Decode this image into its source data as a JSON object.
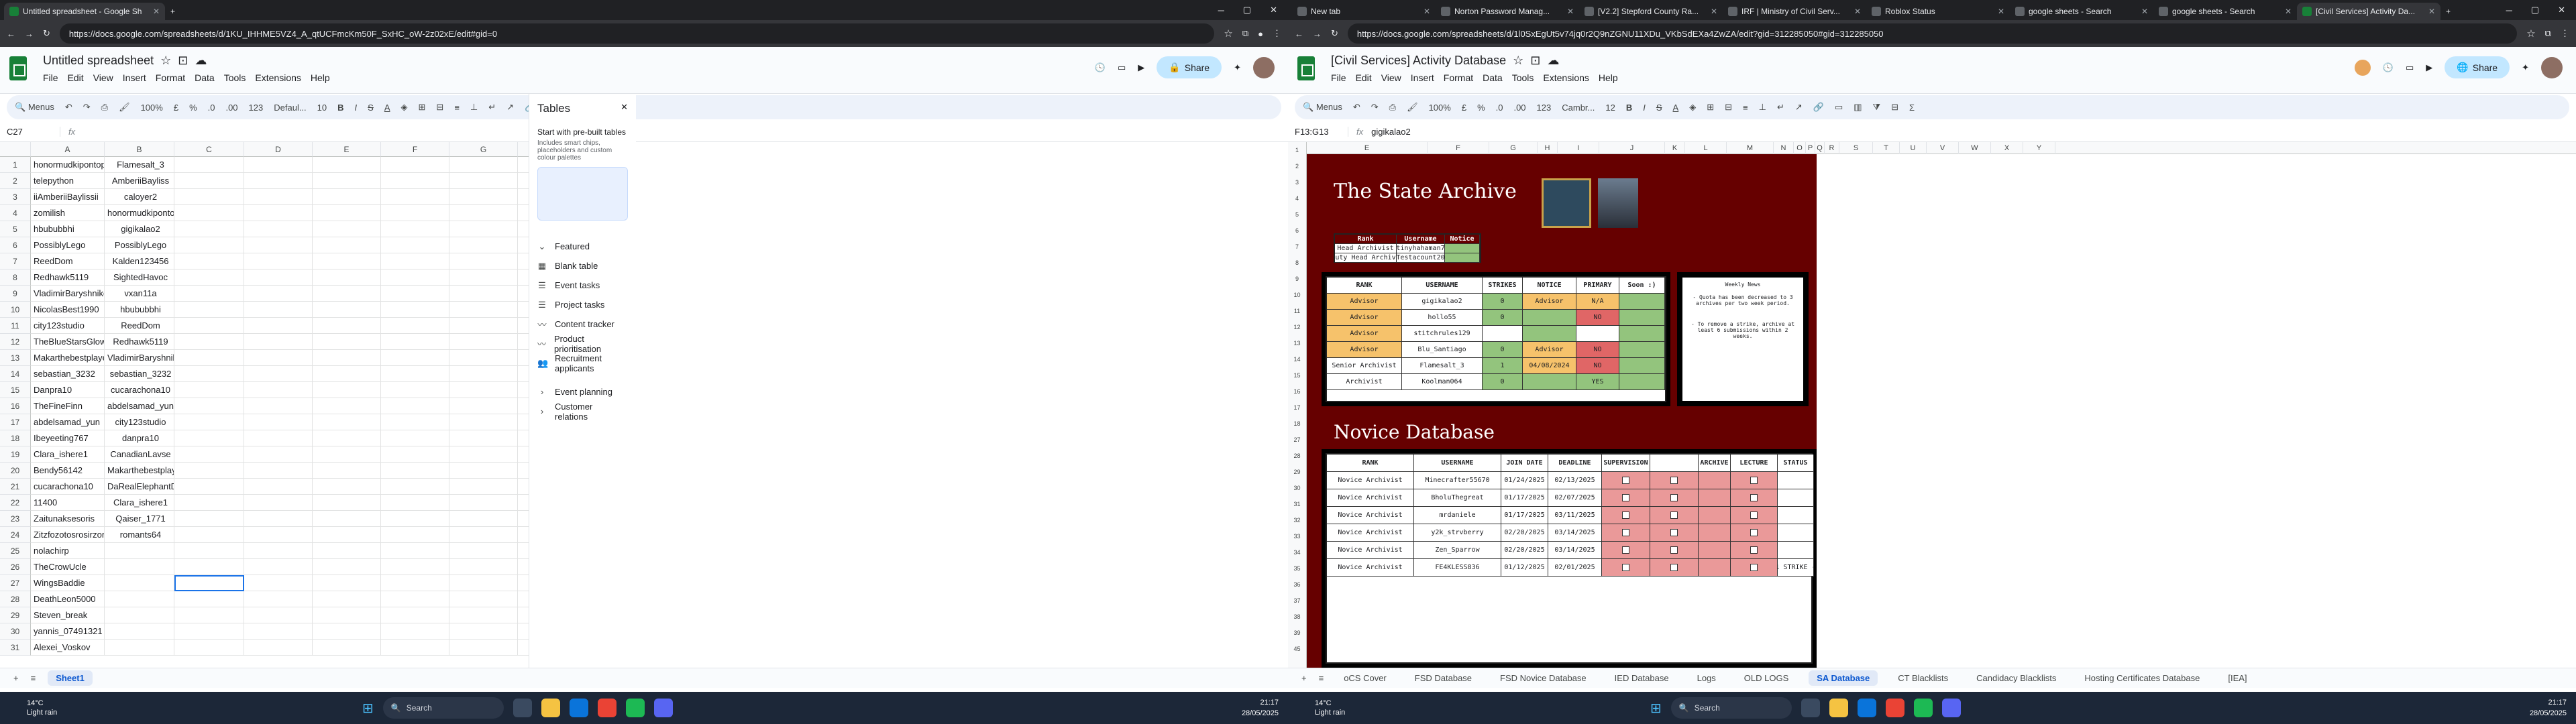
{
  "left": {
    "tabs": [
      {
        "label": "Untitled spreadsheet - Google Sh",
        "active": true
      }
    ],
    "url": "https://docs.google.com/spreadsheets/d/1KU_IHHME5VZ4_A_qtUCFmcKm50F_SxHC_oW-2z02xE/edit#gid=0",
    "doc_title": "Untitled spreadsheet",
    "menus": [
      "File",
      "Edit",
      "View",
      "Insert",
      "Format",
      "Data",
      "Tools",
      "Extensions",
      "Help"
    ],
    "share_label": "Share",
    "toolbar": {
      "menus": "Menus",
      "zoom": "100%",
      "font": "Defaul...",
      "size": "10",
      "pct": "%",
      "dec": ".0",
      "dec2": ".00",
      "num": "123",
      "cur": "£"
    },
    "cell_ref": "C27",
    "fx": "fx",
    "columns": [
      "A",
      "B",
      "C",
      "D",
      "E",
      "F",
      "G",
      "H",
      "I",
      "J",
      "K",
      "L",
      "M",
      "N"
    ],
    "rows": [
      [
        "honormudkipontop",
        "Flamesalt_3"
      ],
      [
        "telepython",
        "AmberiiBayliss"
      ],
      [
        "iiAmberiiBaylissii",
        "caloyer2"
      ],
      [
        "zomilish",
        "honormudkipontop"
      ],
      [
        "hbububbhi",
        "gigikalao2"
      ],
      [
        "PossiblyLego",
        "PossiblyLego"
      ],
      [
        "ReedDom",
        "Kalden123456"
      ],
      [
        "Redhawk5119",
        "SightedHavoc"
      ],
      [
        "VladimirBaryshnikov",
        "vxan11a"
      ],
      [
        "NicolasBest1990",
        "hbububbhi"
      ],
      [
        "city123studio",
        "ReedDom"
      ],
      [
        "TheBlueStarsGlow",
        "Redhawk5119"
      ],
      [
        "Makarthebestplayer",
        "VladimirBaryshnikov"
      ],
      [
        "sebastian_3232",
        "sebastian_3232"
      ],
      [
        "Danpra10",
        "cucarachona10"
      ],
      [
        "TheFineFinn",
        "abdelsamad_yun"
      ],
      [
        "abdelsamad_yun",
        "city123studio"
      ],
      [
        "Ibeyeeting767",
        "danpra10"
      ],
      [
        "Clara_ishere1",
        "CanadianLavse"
      ],
      [
        "Bendy56142",
        "Makarthebestplayer"
      ],
      [
        "cucarachona10",
        "DaRealElephantDW"
      ],
      [
        "11400",
        "Clara_ishere1"
      ],
      [
        "Zaitunaksesoris",
        "Qaiser_1771"
      ],
      [
        "Zitzfozotosrosirzor",
        "romants64"
      ],
      [
        "nolachirp",
        ""
      ],
      [
        "TheCrowUcle",
        ""
      ],
      [
        "WingsBaddie",
        ""
      ],
      [
        "DeathLeon5000",
        ""
      ],
      [
        "Steven_break",
        ""
      ],
      [
        "yannis_07491321",
        ""
      ],
      [
        "Alexei_Voskov",
        ""
      ]
    ],
    "sheet_tab": "Sheet1",
    "panel": {
      "title": "Tables",
      "subtitle": "Start with pre-built tables",
      "desc": "Includes smart chips, placeholders and custom colour palettes",
      "featured": "Featured",
      "items": [
        "Blank table",
        "Event tasks",
        "Project tasks",
        "Content tracker",
        "Product prioritisation",
        "Recruitment applicants"
      ],
      "sections": [
        "Event planning",
        "Customer relations"
      ]
    }
  },
  "right": {
    "tabs": [
      {
        "label": "New tab"
      },
      {
        "label": "Norton Password Manag..."
      },
      {
        "label": "[V2.2] Stepford County Ra..."
      },
      {
        "label": "IRF | Ministry of Civil Serv..."
      },
      {
        "label": "Roblox Status"
      },
      {
        "label": "google sheets - Search"
      },
      {
        "label": "google sheets - Search"
      },
      {
        "label": "[Civil Services] Activity Da...",
        "active": true
      }
    ],
    "url": "https://docs.google.com/spreadsheets/d/1l0SxEgUt5v74jq0r2Q9nZGNU11XDu_VKbSdEXa4ZwZA/edit?gid=312285050#gid=312285050",
    "doc_title": "[Civil Services] Activity Database",
    "menus": [
      "File",
      "Edit",
      "View",
      "Insert",
      "Format",
      "Data",
      "Tools",
      "Extensions",
      "Help"
    ],
    "share_label": "Share",
    "toolbar": {
      "menus": "Menus",
      "zoom": "100%",
      "font": "Cambr...",
      "size": "12",
      "pct": "%",
      "dec": ".0",
      "dec2": ".00",
      "num": "123",
      "cur": "£"
    },
    "cell_ref": "F13:G13",
    "fx_value": "gigikalao2",
    "columns": [
      "E",
      "F",
      "G",
      "H",
      "I",
      "J",
      "K",
      "L",
      "M",
      "N",
      "O",
      "P",
      "Q",
      "R",
      "S",
      "T",
      "U",
      "V",
      "W",
      "X",
      "Y"
    ],
    "archive_title": "The State Archive",
    "leaders": {
      "headers": [
        "Rank",
        "Username",
        "Notice"
      ],
      "rows": [
        [
          "Head Archivist",
          "tinyhahaman7",
          ""
        ],
        [
          "Deputy Head Archivist",
          "Testacount20",
          ""
        ]
      ]
    },
    "main_headers": [
      "RANK",
      "USERNAME",
      "STRIKES",
      "NOTICE",
      "PRIMARY",
      "Soon :)"
    ],
    "main_rows": [
      [
        "Advisor",
        "gigikalao2",
        "0",
        "Advisor",
        "N/A",
        ""
      ],
      [
        "Advisor",
        "hollo55",
        "0",
        "",
        "NO",
        ""
      ],
      [
        "Advisor",
        "stitchrules129",
        "",
        "",
        "",
        ""
      ],
      [
        "Advisor",
        "Blu_Santiago",
        "0",
        "Advisor",
        "NO",
        ""
      ],
      [
        "Senior Archivist",
        "Flamesalt_3",
        "1",
        "04/08/2024",
        "NO",
        ""
      ],
      [
        "Archivist",
        "Koolman064",
        "0",
        "",
        "YES",
        ""
      ]
    ],
    "news_title": "Weekly News",
    "news": [
      "- Quota has been decreased to 3 archives per two week period.",
      "- To remove a strike, archive at least 6 submissions within 2 weeks."
    ],
    "novice_title": "Novice Database",
    "novice_headers": [
      "RANK",
      "USERNAME",
      "JOIN DATE",
      "DEADLINE",
      "SUPERVISION",
      "",
      "ARCHIVE",
      "LECTURE",
      "STATUS"
    ],
    "novice_rows": [
      [
        "Novice Archivist",
        "Minecrafter55670",
        "01/24/2025",
        "02/13/2025",
        ""
      ],
      [
        "Novice Archivist",
        "BholuThegreat",
        "01/17/2025",
        "02/07/2025",
        ""
      ],
      [
        "Novice Archivist",
        "mrdaniele",
        "01/17/2025",
        "03/11/2025",
        ""
      ],
      [
        "Novice Archivist",
        "y2k_strvberry",
        "02/20/2025",
        "03/14/2025",
        ""
      ],
      [
        "Novice Archivist",
        "Zen_Sparrow",
        "02/20/2025",
        "03/14/2025",
        ""
      ],
      [
        "Novice Archivist",
        "FE4KLESS836",
        "01/12/2025",
        "02/01/2025",
        "1 STRIKE -"
      ]
    ],
    "row_numbers": [
      "1",
      "2",
      "3",
      "4",
      "5",
      "6",
      "7",
      "8",
      "9",
      "10",
      "11",
      "12",
      "13",
      "14",
      "15",
      "16",
      "17",
      "18",
      "27",
      "28",
      "29",
      "30",
      "31",
      "32",
      "33",
      "34",
      "35",
      "36",
      "37",
      "38",
      "39",
      "45"
    ],
    "sheet_tabs": [
      "oCS Cover",
      "FSD Database",
      "FSD Novice Database",
      "IED Database",
      "Logs",
      "OLD LOGS",
      "SA Database",
      "CT Blacklists",
      "Candidacy Blacklists",
      "Hosting Certificates Database",
      "[IEA]"
    ],
    "active_sheet": "SA Database"
  },
  "taskbar": {
    "temp": "14°C",
    "weather": "Light rain",
    "search": "Search",
    "time": "21:17",
    "date": "28/05/2025"
  },
  "colors": {
    "maroon": "#660000",
    "advisor": "#f6c26b",
    "green": "#93c47d",
    "red": "#e06666",
    "pink": "#ea9999"
  }
}
